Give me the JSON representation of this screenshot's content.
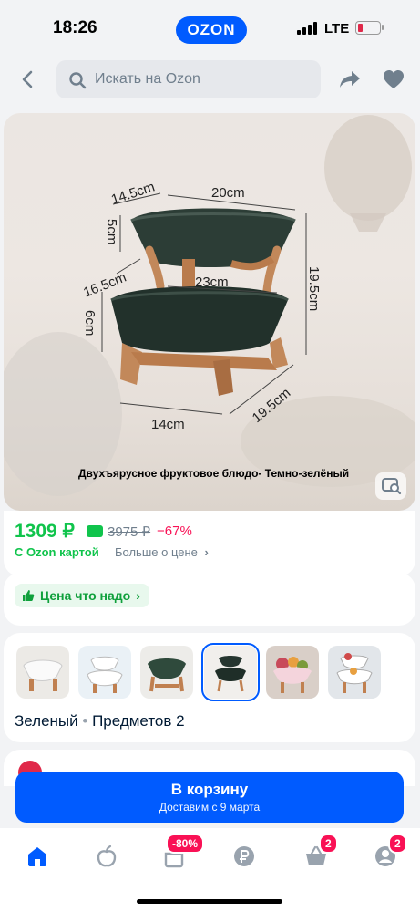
{
  "status_bar": {
    "time": "18:26",
    "brand": "OZON",
    "network": "LTE"
  },
  "search": {
    "placeholder": "Искать на Ozon"
  },
  "product_image": {
    "caption": "Двухъярусное фруктовое блюдо-  Темно-зелёный",
    "dimensions": [
      "14.5cm",
      "20cm",
      "5cm",
      "16.5cm",
      "23cm",
      "19.5cm",
      "6cm",
      "14cm",
      "19.5cm"
    ]
  },
  "price": {
    "current": "1309 ₽",
    "old": "3975 ₽",
    "discount": "−67%",
    "ozon_card_label": "С Ozon картой",
    "more_label": "Больше о цене",
    "more_chevron": "›"
  },
  "tag": {
    "label": "Цена что надо",
    "chevron": "›"
  },
  "variants": {
    "selected_color": "Зеленый",
    "separator": "•",
    "items_label": "Предметов 2",
    "thumbnails": [
      "variant-white",
      "variant-white-two-tier",
      "variant-green",
      "variant-dark-green",
      "variant-pink",
      "variant-white-fruit"
    ]
  },
  "cart": {
    "label": "В корзину",
    "delivery": "Доставим с 9 марта"
  },
  "tabbar": {
    "items": [
      {
        "name": "home-icon",
        "active": true
      },
      {
        "name": "fresh-icon"
      },
      {
        "name": "sale-icon",
        "badge": "-80%"
      },
      {
        "name": "finance-icon"
      },
      {
        "name": "cart-icon",
        "badge": "2"
      },
      {
        "name": "profile-icon",
        "badge": "2"
      }
    ]
  },
  "colors": {
    "accent": "#005bff",
    "price_green": "#10c44c",
    "discount": "#f91155"
  }
}
